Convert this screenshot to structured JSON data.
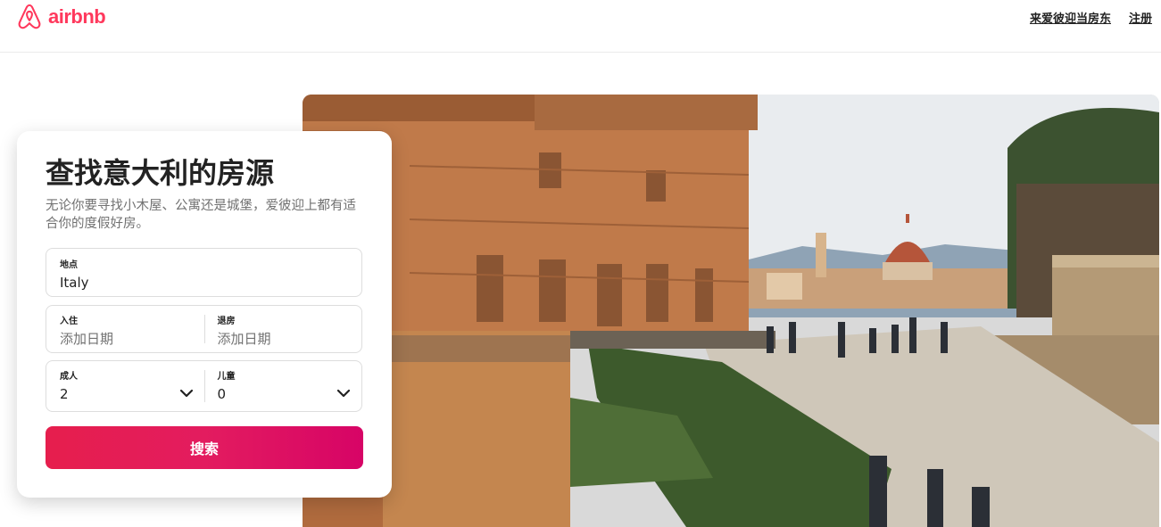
{
  "header": {
    "logo_text": "airbnb",
    "links": {
      "host": "来爱彼迎当房东",
      "signup": "注册"
    }
  },
  "search_card": {
    "title": "查找意大利的房源",
    "subtitle": "无论你要寻找小木屋、公寓还是城堡，爱彼迎上都有适合你的度假好房。",
    "location": {
      "label": "地点",
      "value": "Italy"
    },
    "checkin": {
      "label": "入住",
      "placeholder": "添加日期"
    },
    "checkout": {
      "label": "退房",
      "placeholder": "添加日期"
    },
    "adults": {
      "label": "成人",
      "value": "2"
    },
    "children": {
      "label": "儿童",
      "value": "0"
    },
    "search_button": "搜索"
  },
  "colors": {
    "brand": "#ff385c",
    "button_start": "#e61e4d",
    "button_end": "#d70466"
  },
  "hero_image": {
    "subject": "florence-boboli-garden-photo"
  }
}
